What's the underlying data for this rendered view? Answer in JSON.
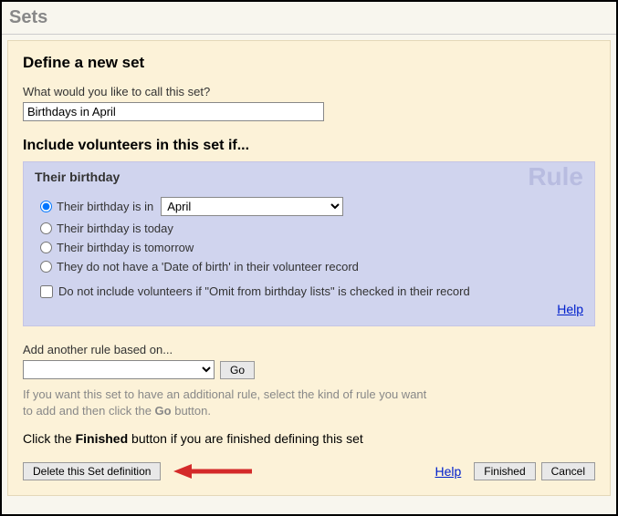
{
  "page_title": "Sets",
  "define_heading": "Define a new set",
  "name_label": "What would you like to call this set?",
  "name_value": "Birthdays in April",
  "include_heading": "Include volunteers in this set if...",
  "rule": {
    "watermark": "Rule",
    "title": "Their birthday",
    "opt_in_prefix": "Their birthday is in",
    "month_selected": "April",
    "opt_today": "Their birthday is today",
    "opt_tomorrow": "Their birthday is tomorrow",
    "opt_no_dob": "They do not have a 'Date of birth' in their volunteer record",
    "omit_checkbox": "Do not include volunteers if \"Omit from birthday lists\" is checked in their record",
    "help": "Help"
  },
  "add_rule_label": "Add another rule based on...",
  "go_label": "Go",
  "hint_line1": "If you want this set to have an additional rule, select the kind of rule you want",
  "hint_line2_prefix": "to add and then click the ",
  "hint_line2_bold": "Go",
  "hint_line2_suffix": " button.",
  "finish_prefix": "Click the ",
  "finish_bold": "Finished",
  "finish_suffix": " button if you are finished defining this set",
  "delete_label": "Delete this Set definition",
  "bottom_help": "Help",
  "finished_label": "Finished",
  "cancel_label": "Cancel"
}
